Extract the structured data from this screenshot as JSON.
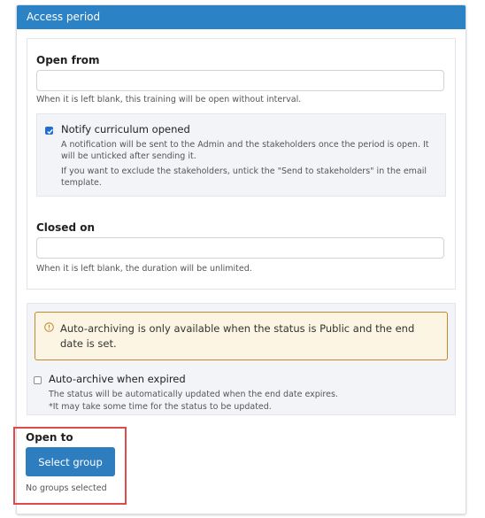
{
  "panel": {
    "title": "Access period"
  },
  "open_from": {
    "label": "Open from",
    "value": "",
    "hint": "When it is left blank, this training will be open without interval."
  },
  "notify": {
    "checked": true,
    "label": "Notify curriculum opened",
    "desc_1": "A notification will be sent to the Admin and the stakeholders once the period is open. It will be unticked after sending it.",
    "desc_2": "If you want to exclude the stakeholders, untick the \"Send to stakeholders\" in the email template."
  },
  "closed_on": {
    "label": "Closed on",
    "value": "",
    "hint": "When it is left blank, the duration will be unlimited."
  },
  "archive": {
    "warning_icon": "alert-circle-icon",
    "warning": "Auto-archiving is only available when the status is Public and the end date is set.",
    "checked": false,
    "label": "Auto-archive when expired",
    "desc_1": "The status will be automatically updated when the end date expires.",
    "desc_2": "*It may take some time for the status to be updated."
  },
  "open_to": {
    "label": "Open to",
    "button": "Select group",
    "status": "No groups selected"
  },
  "colors": {
    "header": "#2b82c4",
    "button": "#2e7dbf",
    "checkbox": "#1f6fd1",
    "warning_bg": "#fdf5e3",
    "warning_border": "#c08a2a",
    "highlight": "#e04a4a"
  }
}
